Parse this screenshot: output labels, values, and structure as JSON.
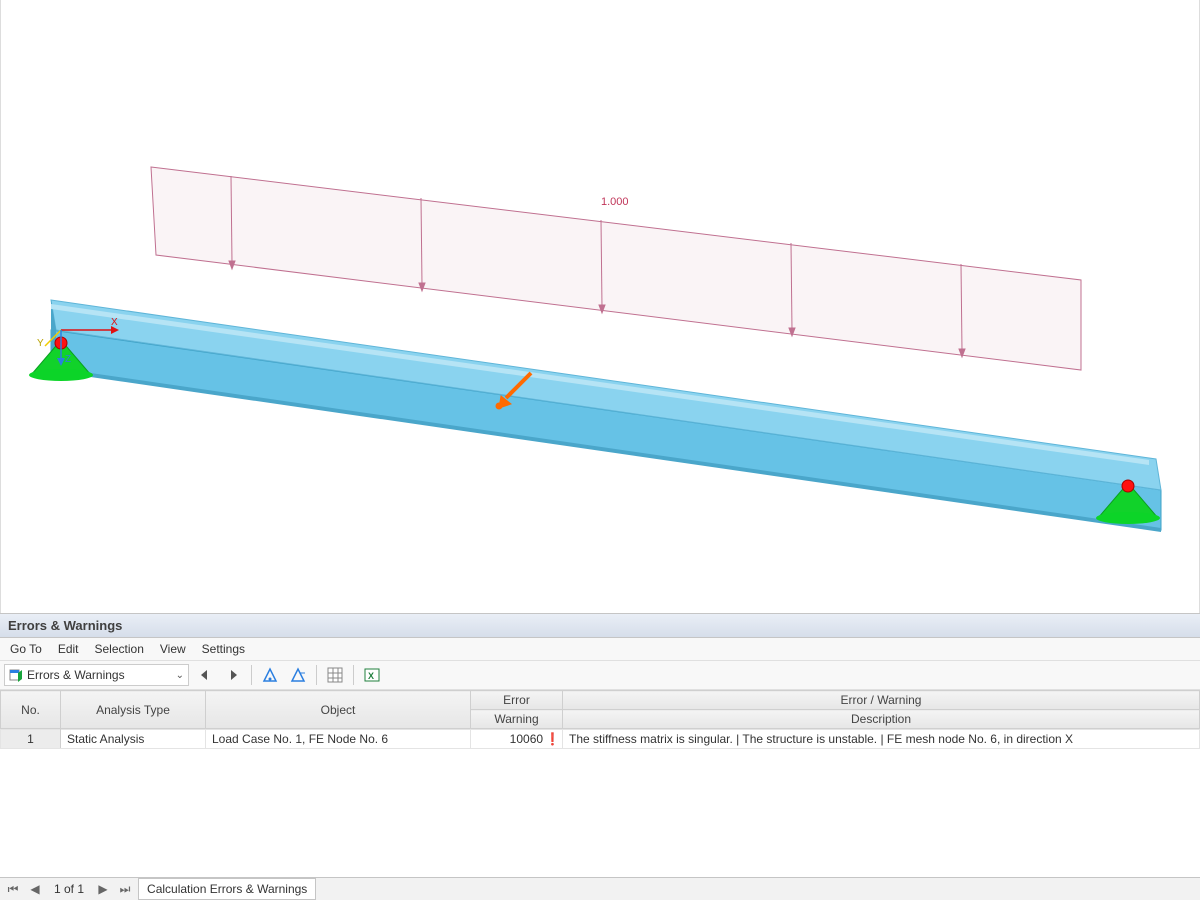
{
  "load_value_label": "1.000",
  "axis": {
    "x": "X",
    "y": "Y",
    "z": "Z"
  },
  "panel": {
    "title": "Errors & Warnings",
    "menu": {
      "goto": "Go To",
      "edit": "Edit",
      "selection": "Selection",
      "view": "View",
      "settings": "Settings"
    },
    "dropdown": "Errors & Warnings",
    "columns": {
      "no": "No.",
      "analysis_type": "Analysis Type",
      "object": "Object",
      "error_top": "Error",
      "error_bot": "Warning",
      "desc_top": "Error / Warning",
      "desc_bot": "Description"
    },
    "rows": [
      {
        "no": "1",
        "analysis_type": "Static Analysis",
        "object": "Load Case No. 1, FE Node No. 6",
        "error": "10060",
        "description": "The stiffness matrix is singular. |  The structure is unstable. | FE mesh node No. 6, in direction X"
      }
    ]
  },
  "status": {
    "page": "1 of 1",
    "tab": "Calculation Errors & Warnings"
  }
}
